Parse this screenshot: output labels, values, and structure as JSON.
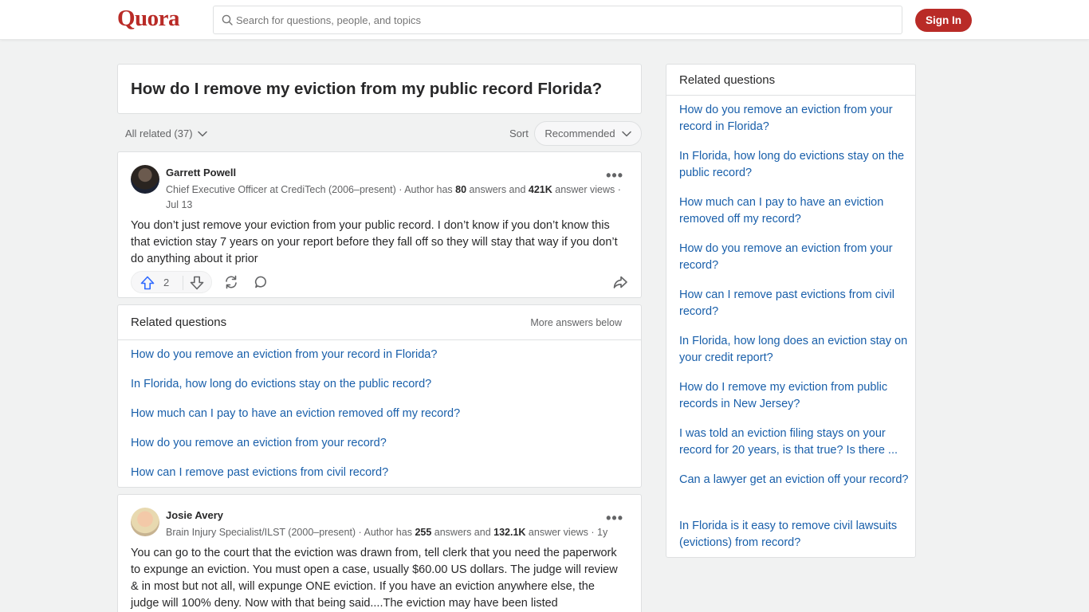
{
  "header": {
    "logo": "Quora",
    "search_placeholder": "Search for questions, people, and topics",
    "signin_label": "Sign In"
  },
  "question": {
    "title": "How do I remove my eviction from my public record Florida?"
  },
  "filters": {
    "all_related": "All related (37)",
    "sort_label": "Sort",
    "sort_value": "Recommended"
  },
  "answers": [
    {
      "author": "Garrett Powell",
      "cred_prefix": "Chief Executive Officer at CrediTech (2006–present) · Author has ",
      "answers_count": "80",
      "answers_mid": " answers and ",
      "views_count": "421K",
      "views_suffix": " answer views · Jul 13",
      "text": "You don’t just remove your eviction from your public record. I don’t know if you don’t know this that eviction stay 7 years on your report before they fall off so they will stay that way if you don’t do anything about it prior",
      "upvotes": "2"
    },
    {
      "author": "Josie Avery",
      "cred_prefix": "Brain Injury Specialist/ILST (2000–present) · Author has ",
      "answers_count": "255",
      "answers_mid": " answers and ",
      "views_count": "132.1K",
      "views_suffix": " answer views · 1y",
      "text": "You can go to the court that the eviction was drawn from, tell clerk that you need the paperwork to expunge an eviction. You must open a case, usually $60.00 US dollars. The judge will review & in most but not all, will expunge ONE eviction. If you have an eviction anywhere else, the judge will 100% deny. Now with that being said....The eviction may have been listed"
    }
  ],
  "related_inline": {
    "title": "Related questions",
    "more": "More answers below",
    "items": [
      "How do you remove an eviction from your record in Florida?",
      "In Florida, how long do evictions stay on the public record?",
      "How much can I pay to have an eviction removed off my record?",
      "How do you remove an eviction from your record?",
      "How can I remove past evictions from civil record?"
    ]
  },
  "related_side": {
    "title": "Related questions",
    "items": [
      "How do you remove an eviction from your record in Florida?",
      "In Florida, how long do evictions stay on the public record?",
      "How much can I pay to have an eviction removed off my record?",
      "How do you remove an eviction from your record?",
      "How can I remove past evictions from civil record?",
      "In Florida, how long does an eviction stay on your credit report?",
      "How do I remove my eviction from public records in New Jersey?",
      "I was told an eviction filing stays on your record for 20 years, is that true? Is there ...",
      "Can a lawyer get an eviction off your record?",
      "In Florida is it easy to remove civil lawsuits (evictions) from record?"
    ]
  },
  "colors": {
    "brand": "#b92b27",
    "link": "#195faa",
    "upvote": "#2e69ff"
  }
}
